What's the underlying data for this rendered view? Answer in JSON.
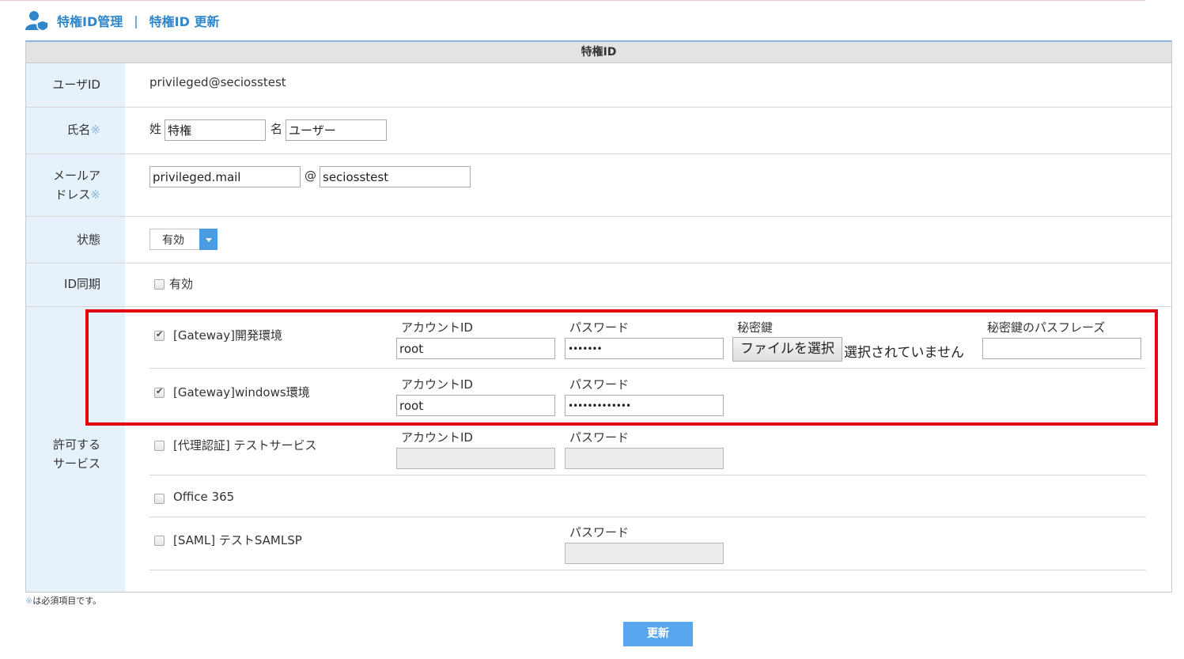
{
  "header": {
    "title": "特権ID管理",
    "separator": "|",
    "subtitle": "特権ID 更新"
  },
  "panel": {
    "title": "特権ID"
  },
  "user_id": {
    "label": "ユーザID",
    "value": "privileged@seciosstest"
  },
  "name": {
    "label": "氏名",
    "required_mark": "※",
    "last_label": "姓",
    "last_value": "特権",
    "first_label": "名",
    "first_value": "ユーザー"
  },
  "email": {
    "label_line1": "メールア",
    "label_line2": "ドレス",
    "required_mark": "※",
    "local_value": "privileged.mail",
    "at": "@",
    "domain_value": "seciosstest"
  },
  "status": {
    "label": "状態",
    "selected": "有効"
  },
  "id_sync": {
    "label": "ID同期",
    "checkbox_label": "有効",
    "checked": false
  },
  "services": {
    "label_line1": "許可する",
    "label_line2": "サービス",
    "items": [
      {
        "name": "[Gateway]開発環境",
        "checked": true,
        "account_label": "アカウントID",
        "account_value": "root",
        "password_label": "パスワード",
        "password_value": "•••••••",
        "secret_key_label": "秘密鍵",
        "file_button": "ファイルを選択",
        "file_status": "選択されていません",
        "passphrase_label": "秘密鍵のパスフレーズ",
        "passphrase_value": ""
      },
      {
        "name": "[Gateway]windows環境",
        "checked": true,
        "account_label": "アカウントID",
        "account_value": "root",
        "password_label": "パスワード",
        "password_value": "•••••••••••••"
      },
      {
        "name": "[代理認証] テストサービス",
        "checked": false,
        "account_label": "アカウントID",
        "account_value": "",
        "password_label": "パスワード",
        "password_value": ""
      },
      {
        "name": "Office 365",
        "checked": false
      },
      {
        "name": "[SAML] テストSAMLSP",
        "checked": false,
        "password_label": "パスワード",
        "password_value": ""
      }
    ]
  },
  "footer": {
    "note_mark": "※",
    "note_text": "は必須項目です。",
    "submit_label": "更新"
  },
  "colors": {
    "accent": "#2f86c8",
    "label_bg": "#e6f2fb",
    "highlight": "#e3000e",
    "button": "#57a6ee"
  }
}
